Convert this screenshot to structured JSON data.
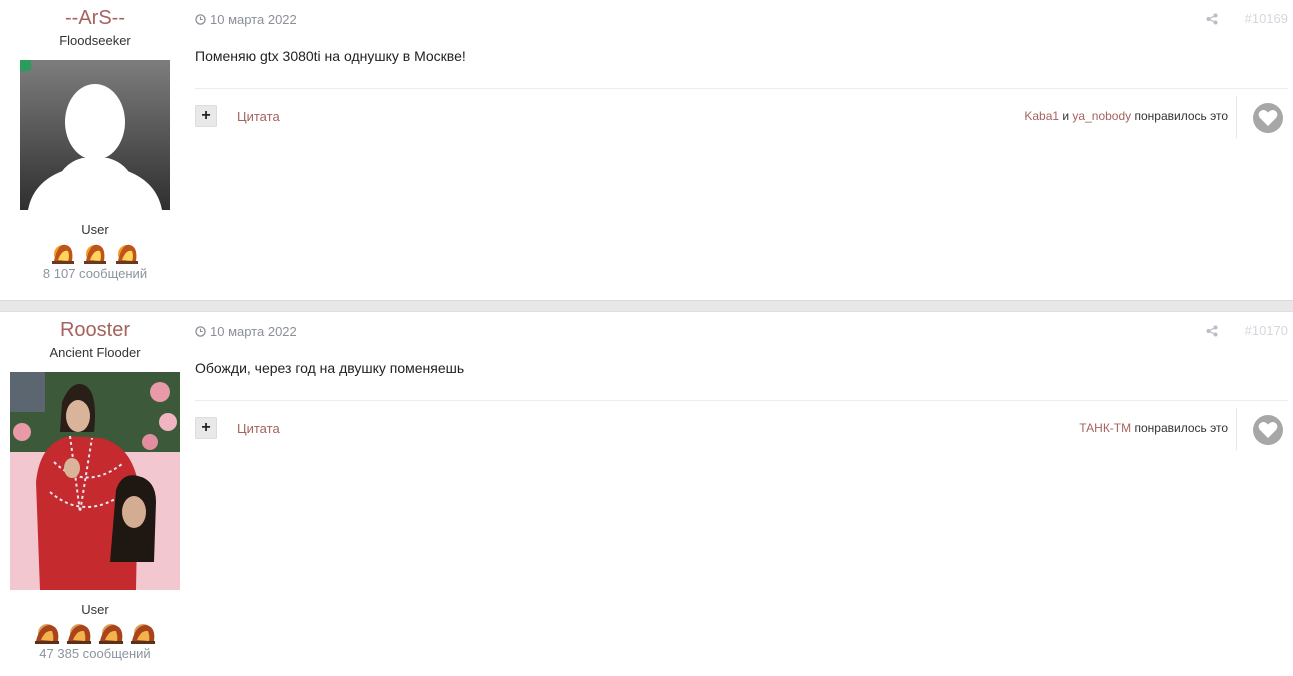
{
  "posts": [
    {
      "author": {
        "name": "--ArS--",
        "title": "Floodseeker",
        "group": "User",
        "posts_count": "8 107 сообщений",
        "online": true,
        "rank_icons": 3
      },
      "date": "10 марта 2022",
      "number": "#10169",
      "text": "Поменяю gtx 3080ti на однушку в Москве!",
      "quote_label": "Цитата",
      "likes": {
        "user1": "Kaba1",
        "conj": " и ",
        "user2": "ya_nobody",
        "suffix": " понравилось это"
      }
    },
    {
      "author": {
        "name": "Rooster",
        "title": "Ancient Flooder",
        "group": "User",
        "posts_count": "47 385 сообщений",
        "online": false,
        "rank_icons": 4
      },
      "date": "10 марта 2022",
      "number": "#10170",
      "text": "Обожди, через год на двушку поменяешь",
      "quote_label": "Цитата",
      "likes": {
        "user1": "ТАНК-ТМ",
        "suffix": " понравилось это"
      }
    }
  ],
  "colors": {
    "link": "#a5625f",
    "online": "#2a9d5c",
    "muted": "#8a94a0"
  }
}
